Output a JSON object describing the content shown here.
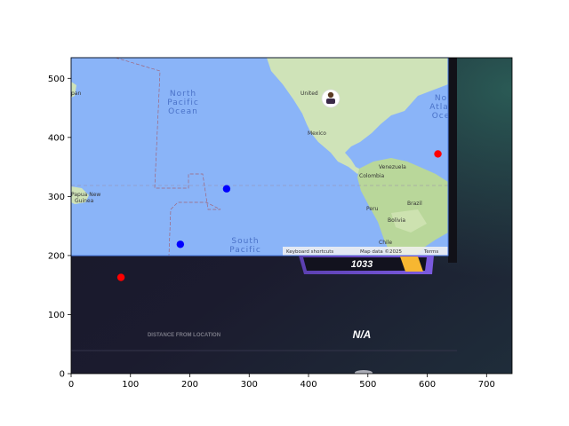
{
  "axes": {
    "xlim": [
      0,
      743
    ],
    "ylim": [
      535,
      0
    ],
    "xticks": [
      0,
      100,
      200,
      300,
      400,
      500,
      600,
      700
    ],
    "yticks": [
      0,
      100,
      200,
      300,
      400,
      500
    ]
  },
  "map": {
    "ocean_labels": [
      "North",
      "Pacific",
      "Ocean",
      "South",
      "Pacific",
      "No",
      "Atla",
      "Oce"
    ],
    "country_labels": [
      "United",
      "Mexico",
      "Venezuela",
      "Colombia",
      "Peru",
      "Brazil",
      "Bolivia",
      "Chile",
      "Papua New",
      "Guinea",
      "pan"
    ],
    "attribution": [
      "Keyboard shortcuts",
      "Map data ©2025",
      "Terms"
    ],
    "ocean_color": "#8ab4f8"
  },
  "hud": {
    "score": "1033",
    "distance_label": "DISTANCE FROM LOCATION",
    "distance_value": "N/A",
    "score_bar_color": "#6b4cc9",
    "badge_color": "#f7b731"
  },
  "markers": [
    {
      "x": 84,
      "y": 163,
      "color": "#ff0000"
    },
    {
      "x": 184,
      "y": 219,
      "color": "#0000ff"
    },
    {
      "x": 262,
      "y": 313,
      "color": "#0000ff"
    },
    {
      "x": 618,
      "y": 372,
      "color": "#ff0000"
    }
  ],
  "guess_line": {
    "x1": 0,
    "y1": 175,
    "x2": 370,
    "y2": 75
  },
  "avatar_icon": "person-avatar-icon"
}
